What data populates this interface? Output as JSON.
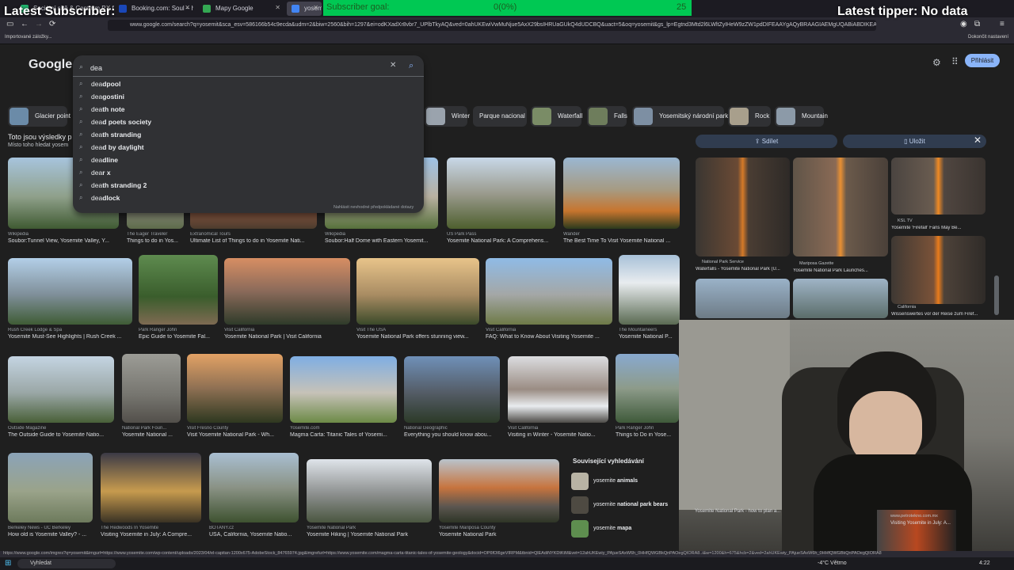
{
  "tabs": [
    {
      "label": "Sociální sítě & Centrum P... fox",
      "color": "#21b36d"
    },
    {
      "label": "Booking.com: Soul – hotely, Re",
      "color": "#1a47b8"
    },
    {
      "label": "Mapy Google",
      "color": "#34a853"
    },
    {
      "label": "yosemit – H",
      "color": "#4285f4"
    }
  ],
  "url": "www.google.com/search?q=yosemit&sca_esv=586166b54c9ecda&udm=2&biw=2560&bih=1297&ei=odKXadXr8vbr7_UPlbTkyAQ&ved=0ahUKEwiVwMuNjue5AxX29bsIHRUaGUkQ4dUDCBQ&uact=5&oq=yosemit&gs_lp=Egtnd3Mtd2l6LWltZyIHeW9zZW1pdDIFEAAYgAQyBRAAGIAEMgUQABiABDIKEAAYgAQY",
  "bookmarks": {
    "left": "Importované záložky...",
    "right": "Dokončit nastavení"
  },
  "overlays": {
    "subscriber": "Latest Subscriber:",
    "goal_label": "Subscriber goal:",
    "goal_value": "0(0%)",
    "goal_target": "25",
    "tipper": "Latest tipper: No data"
  },
  "google": {
    "logo": "Google",
    "signin": "Přihlásit",
    "search_value": "dea",
    "report": "Nahlásit nevhodné předpokládané dotazy"
  },
  "suggestions": [
    {
      "pre": "dea",
      "post": "dpool"
    },
    {
      "pre": "dea",
      "post": "gostini"
    },
    {
      "pre": "dea",
      "post": "th note"
    },
    {
      "pre": "dea",
      "post": "d poets society"
    },
    {
      "pre": "dea",
      "post": "th stranding"
    },
    {
      "pre": "dea",
      "post": "d by daylight"
    },
    {
      "pre": "dea",
      "post": "dline"
    },
    {
      "pre": "dea",
      "post": "r x"
    },
    {
      "pre": "dea",
      "post": "th stranding 2"
    },
    {
      "pre": "dea",
      "post": "dlock"
    }
  ],
  "chips": [
    "Glacier point",
    "Winter",
    "Parque nacional",
    "Waterfall",
    "Falls",
    "Yosemitský národní park",
    "Rock",
    "Mountain"
  ],
  "notice": {
    "line1": "Toto jsou výsledky p",
    "line2": "Místo toho hledat yosem"
  },
  "grid": [
    {
      "src": "Wikipedia",
      "cap": "Soubor:Tunnel View, Yosemite Valley, Y..."
    },
    {
      "src": "The Eager Traveler",
      "cap": "Things to do in Yos..."
    },
    {
      "src": "Extranomical Tours",
      "cap": "Ultimate List of Things to do in Yosemite Nati..."
    },
    {
      "src": "Wikipedia",
      "cap": "Soubor:Half Dome with Eastern Yosemit..."
    },
    {
      "src": "US Park Pass",
      "cap": "Yosemite National Park: A Comprehens..."
    },
    {
      "src": "Wander",
      "cap": "The Best Time To Visit Yosemite National ..."
    },
    {
      "src": "Rush Creek Lodge & Spa",
      "cap": "Yosemite Must-See Highlights | Rush Creek ..."
    },
    {
      "src": "Park Ranger John",
      "cap": "Epic Guide to Yosemite Fal..."
    },
    {
      "src": "Visit California",
      "cap": "Yosemite National Park | Visit California"
    },
    {
      "src": "Visit The USA",
      "cap": "Yosemite National Park offers stunning view..."
    },
    {
      "src": "Visit California",
      "cap": "FAQ: What to Know About Visiting Yosemite ..."
    },
    {
      "src": "The Mountaineers",
      "cap": "Yosemite National P..."
    },
    {
      "src": "Outside Magazine",
      "cap": "The Outside Guide to Yosemite Natio..."
    },
    {
      "src": "National Park Foun...",
      "cap": "Yosemite National ..."
    },
    {
      "src": "Visit Fresno County",
      "cap": "Visit Yosemite National Park - Wh..."
    },
    {
      "src": "Yosemite.com",
      "cap": "Magma Carta: Titanic Tales of Yosemi..."
    },
    {
      "src": "National Geographic",
      "cap": "Everything you should know abou..."
    },
    {
      "src": "Visit California",
      "cap": "Visiting in Winter - Yosemite Natio..."
    },
    {
      "src": "Park Ranger John",
      "cap": "Things to Do in Yose..."
    },
    {
      "src": "Berkeley News - UC Berkeley",
      "cap": "How old is Yosemite Valley? - ..."
    },
    {
      "src": "The Redwoods In Yosemite",
      "cap": "Visiting Yosemite in July: A Compre..."
    },
    {
      "src": "BOTANY.cz",
      "cap": "USA, California, Yosemite Natio..."
    },
    {
      "src": "Yosemite National Park",
      "cap": "Yosemite Hiking | Yosemite National Park"
    },
    {
      "src": "Yosemite Mariposa County",
      "cap": "Yosemite National Park"
    }
  ],
  "related": {
    "title": "Související vyhledávání",
    "items": [
      {
        "pre": "yosemite ",
        "bold": "animals"
      },
      {
        "pre": "yosemite ",
        "bold": "national park bears"
      },
      {
        "pre": "yosemite ",
        "bold": "mapa"
      }
    ]
  },
  "panel": {
    "share": "Sdílet",
    "save": "Uložit",
    "items": [
      {
        "src": "KSL TV",
        "cap": "Yosemite 'Firefall' Fans May Be..."
      },
      {
        "src": "National Park Service",
        "cap": "Waterfalls - Yosemite National Park (U..."
      },
      {
        "src": "Mariposa Gazette",
        "cap": "Yosemite National Park Launches..."
      },
      {
        "src": "California",
        "cap": "Wissenswertes vor der Reise zum Firef..."
      },
      {
        "src": "",
        "cap": "Yosemite National Park - how to plan a..."
      },
      {
        "src": "www.petrotekno.com.mx",
        "cap": "Visiting Yosemite in July: A..."
      }
    ]
  },
  "statusline": "https://www.google.com/imgres?q=yosemit&imgurl=https://www.yosemite.com/wp-content/uploads/2023/04/el-capitan-1200x675-AdobeStock_84765974.jpg&imgrefurl=https://www.yosemite.com/magma-carta-titanic-tales-of-yosemite-geology&docid=OP6fOl6geVIRPM&tbnid=QlEAdiNYKDtKtM&vet=12ahUKEwiy_PAjueSAxW6h_0HHfQWGBkQnPAOegQIORA8..i&w=1200&h=675&hcb=2&ved=2ahUKEwiy_PAjueSAxW6h_0HHfQWGBkQnPAOegQIORA8",
  "taskbar": {
    "search": "Vyhledat",
    "weather": "-4°C Větrno",
    "time": "4:22"
  },
  "colors": {
    "accent": "#8ab4f8",
    "goal": "#00c853",
    "bg": "#1f1f1f"
  }
}
